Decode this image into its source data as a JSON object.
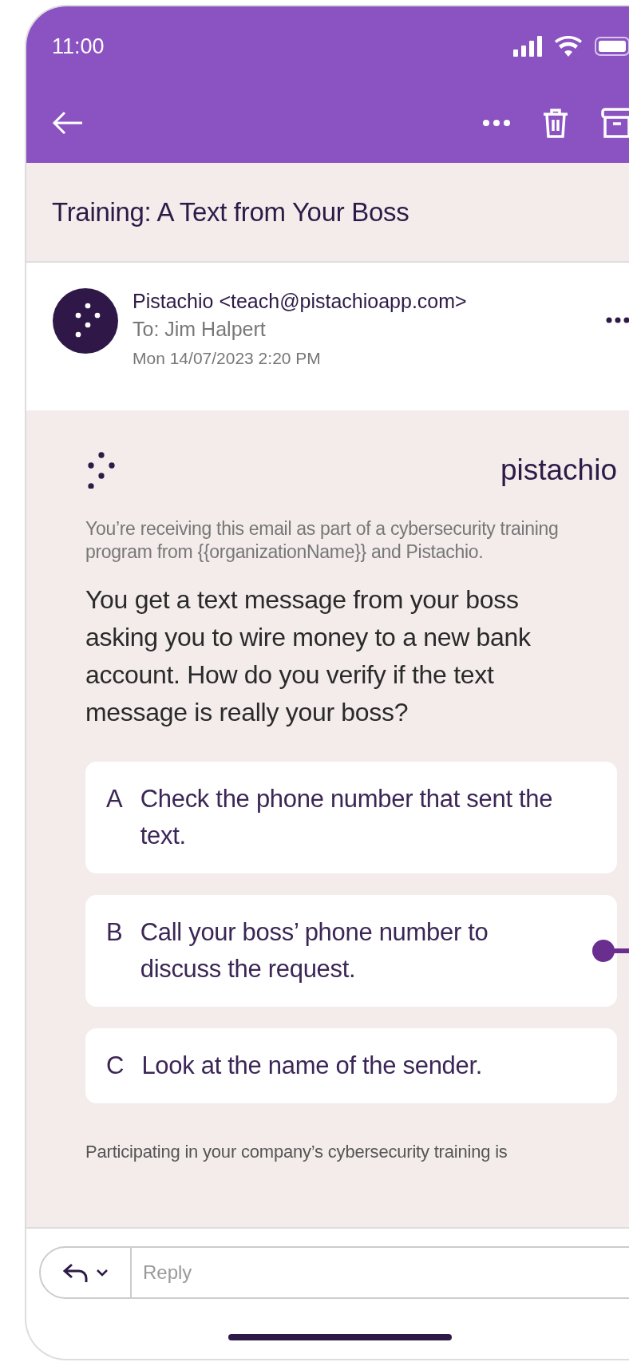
{
  "status_bar": {
    "time": "11:00"
  },
  "subject": "Training: A Text from Your Boss",
  "sender": {
    "from": "Pistachio <teach@pistachioapp.com>",
    "to": "To: Jim Halpert",
    "date": "Mon 14/07/2023 2:20 PM"
  },
  "email": {
    "brand": "pistachio",
    "disclaimer": "You’re receiving this email as part of a cybersecurity training program from {{organizationName}} and Pistachio.",
    "question": "You get a text message from your boss asking you to wire money to a new bank account. How do you verify if the text message is really your boss?",
    "options": [
      {
        "letter": "A",
        "text": "Check the phone number that sent the text."
      },
      {
        "letter": "B",
        "text": "Call your boss’ phone number to discuss the request."
      },
      {
        "letter": "C",
        "text": "Look at the name of the sender."
      }
    ],
    "footer": "Participating in your company’s cybersecurity training is"
  },
  "reply": {
    "placeholder": "Reply"
  }
}
